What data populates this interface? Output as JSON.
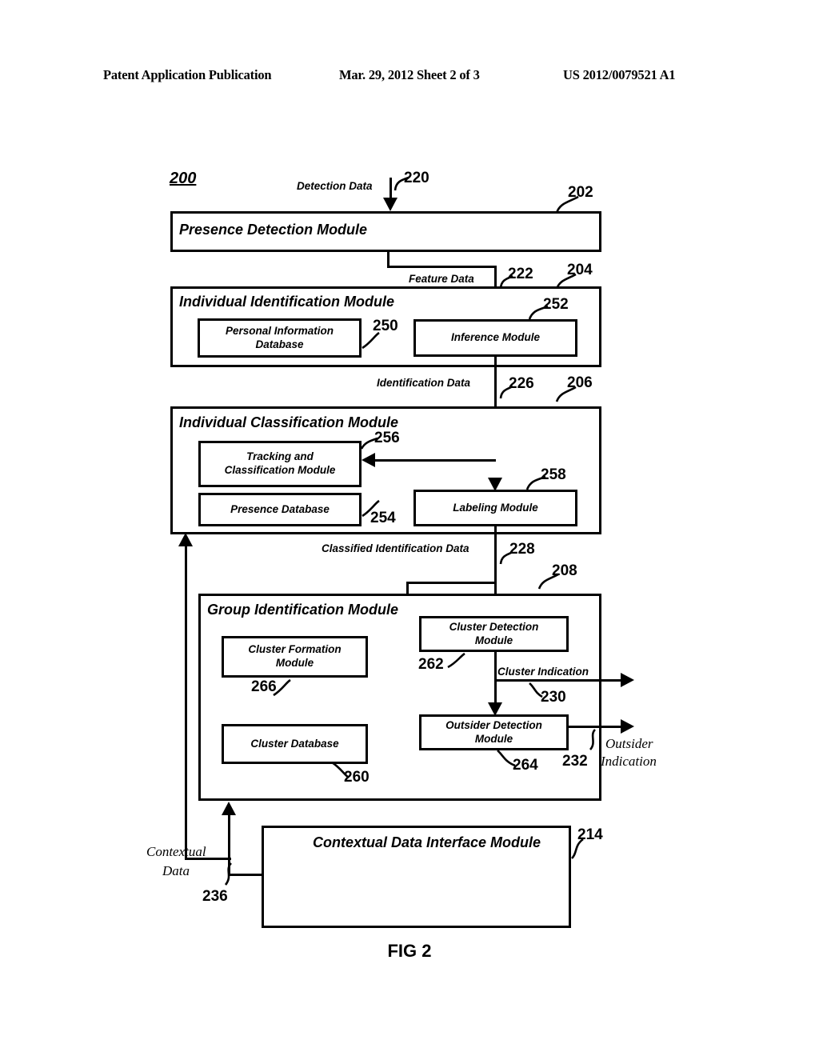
{
  "header": {
    "publication": "Patent Application Publication",
    "date_sheet": "Mar. 29, 2012  Sheet 2 of 3",
    "patent_number": "US 2012/0079521 A1"
  },
  "figure": {
    "caption": "FIG 2",
    "system_ref": "200"
  },
  "modules": [
    {
      "ref": "202",
      "title": "Presence Detection Module",
      "children": []
    },
    {
      "ref": "204",
      "title": "Individual Identification Module",
      "children": [
        {
          "ref": "250",
          "label": "Personal Information Database"
        },
        {
          "ref": "252",
          "label": "Inference Module"
        }
      ]
    },
    {
      "ref": "206",
      "title": "Individual Classification Module",
      "children": [
        {
          "ref": "256",
          "label": "Tracking and Classification Module"
        },
        {
          "ref": "254",
          "label": "Presence Database"
        },
        {
          "ref": "258",
          "label": "Labeling Module"
        }
      ]
    },
    {
      "ref": "208",
      "title": "Group Identification Module",
      "children": [
        {
          "ref": "266",
          "label": "Cluster Formation Module"
        },
        {
          "ref": "260",
          "label": "Cluster Database"
        },
        {
          "ref": "262",
          "label": "Cluster Detection Module"
        },
        {
          "ref": "264",
          "label": "Outsider Detection Module"
        }
      ]
    },
    {
      "ref": "214",
      "title": "Contextual Data Interface Module",
      "children": []
    }
  ],
  "flows": [
    {
      "ref": "220",
      "label": "Detection Data"
    },
    {
      "ref": "222",
      "label": "Feature Data"
    },
    {
      "ref": "226",
      "label": "Identification Data"
    },
    {
      "ref": "228",
      "label": "Classified Identification Data"
    },
    {
      "ref": "230",
      "label": "Cluster Indication"
    },
    {
      "ref": "232",
      "label": "Outsider Indication"
    },
    {
      "ref": "236",
      "label": "Contextual Data"
    }
  ],
  "flow_labels": {
    "detection_data": "Detection Data",
    "feature_data": "Feature Data",
    "identification_data": "Identification Data",
    "classified_identification_data": "Classified Identification Data",
    "cluster_indication": "Cluster Indication",
    "outsider_indication_1": "Outsider",
    "outsider_indication_2": "Indication",
    "contextual_data_1": "Contextual",
    "contextual_data_2": "Data"
  },
  "refs": {
    "r200": "200",
    "r202": "202",
    "r204": "204",
    "r206": "206",
    "r208": "208",
    "r214": "214",
    "r220": "220",
    "r222": "222",
    "r226": "226",
    "r228": "228",
    "r230": "230",
    "r232": "232",
    "r236": "236",
    "r250": "250",
    "r252": "252",
    "r254": "254",
    "r256": "256",
    "r258": "258",
    "r260": "260",
    "r262": "262",
    "r264": "264",
    "r266": "266"
  },
  "box_labels": {
    "presence_detection": "Presence Detection Module",
    "individual_identification": "Individual Identification Module",
    "personal_information_database_1": "Personal Information",
    "personal_information_database_2": "Database",
    "inference_module": "Inference Module",
    "individual_classification": "Individual Classification Module",
    "tracking_classification_1": "Tracking and",
    "tracking_classification_2": "Classification Module",
    "presence_database": "Presence Database",
    "labeling_module": "Labeling Module",
    "group_identification": "Group Identification Module",
    "cluster_formation_1": "Cluster Formation",
    "cluster_formation_2": "Module",
    "cluster_database": "Cluster Database",
    "cluster_detection_1": "Cluster Detection",
    "cluster_detection_2": "Module",
    "outsider_detection_1": "Outsider Detection",
    "outsider_detection_2": "Module",
    "contextual_data_interface": "Contextual Data Interface Module"
  },
  "colors": {
    "ink": "#000000",
    "paper": "#ffffff"
  }
}
